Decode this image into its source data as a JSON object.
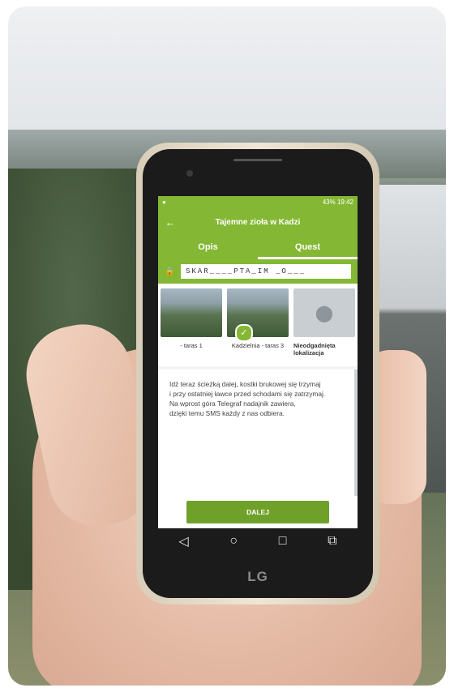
{
  "status_bar": {
    "left_icon": "app-icon",
    "battery": "43%",
    "time": "19:42"
  },
  "app_bar": {
    "back_icon": "arrow-left-icon",
    "title": "Tajemne zioła w Kadzi"
  },
  "tabs": [
    {
      "label": "Opis",
      "active": false
    },
    {
      "label": "Quest",
      "active": true
    }
  ],
  "code": {
    "icon": "lock-icon",
    "value": "SKAR____PTA_IM _O___"
  },
  "cards": [
    {
      "label": "- taras 1",
      "checked": false,
      "unknown": false
    },
    {
      "label": "Kadzielnia - taras 3",
      "checked": true,
      "unknown": false
    },
    {
      "label": "Nieodgadnięta lokalizacja",
      "checked": false,
      "unknown": true
    }
  ],
  "content": {
    "lines": [
      "Idź teraz ścieżką dalej, kostki brukowej się trzymaj",
      "i przy ostatniej ławce przed schodami się zatrzymaj.",
      "Na wprost góra Telegraf nadajnik zawiera,",
      "dzięki temu SMS każdy z nas odbiera."
    ]
  },
  "button": {
    "label": "DALEJ"
  },
  "phone_brand": "LG",
  "colors": {
    "accent": "#84b734",
    "button": "#6fa12a"
  }
}
